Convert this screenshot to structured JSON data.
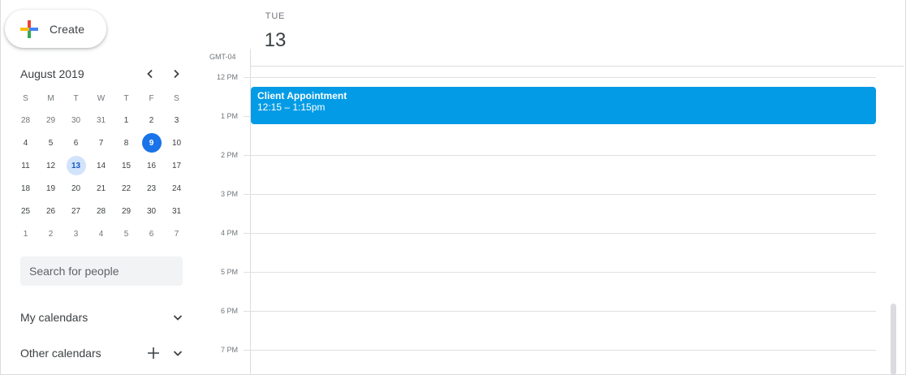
{
  "create": {
    "label": "Create",
    "icon": "google-plus-icon"
  },
  "mini_calendar": {
    "title": "August 2019",
    "prev_icon": "chevron-left-icon",
    "next_icon": "chevron-right-icon",
    "weekdays": [
      "S",
      "M",
      "T",
      "W",
      "T",
      "F",
      "S"
    ],
    "weeks": [
      [
        {
          "d": "28",
          "other": true
        },
        {
          "d": "29",
          "other": true
        },
        {
          "d": "30",
          "other": true
        },
        {
          "d": "31",
          "other": true
        },
        {
          "d": "1"
        },
        {
          "d": "2"
        },
        {
          "d": "3"
        }
      ],
      [
        {
          "d": "4"
        },
        {
          "d": "5"
        },
        {
          "d": "6"
        },
        {
          "d": "7"
        },
        {
          "d": "8"
        },
        {
          "d": "9",
          "today": true
        },
        {
          "d": "10"
        }
      ],
      [
        {
          "d": "11"
        },
        {
          "d": "12"
        },
        {
          "d": "13",
          "selected": true
        },
        {
          "d": "14"
        },
        {
          "d": "15"
        },
        {
          "d": "16"
        },
        {
          "d": "17"
        }
      ],
      [
        {
          "d": "18"
        },
        {
          "d": "19"
        },
        {
          "d": "20"
        },
        {
          "d": "21"
        },
        {
          "d": "22"
        },
        {
          "d": "23"
        },
        {
          "d": "24"
        }
      ],
      [
        {
          "d": "25"
        },
        {
          "d": "26"
        },
        {
          "d": "27"
        },
        {
          "d": "28"
        },
        {
          "d": "29"
        },
        {
          "d": "30"
        },
        {
          "d": "31"
        }
      ],
      [
        {
          "d": "1",
          "other": true
        },
        {
          "d": "2",
          "other": true
        },
        {
          "d": "3",
          "other": true
        },
        {
          "d": "4",
          "other": true
        },
        {
          "d": "5",
          "other": true
        },
        {
          "d": "6",
          "other": true
        },
        {
          "d": "7",
          "other": true
        }
      ]
    ]
  },
  "search": {
    "placeholder": "Search for people"
  },
  "my_calendars": {
    "label": "My calendars"
  },
  "other_calendars": {
    "label": "Other calendars"
  },
  "day_view": {
    "day_of_week": "TUE",
    "date": "13",
    "timezone": "GMT-04",
    "hours": [
      "12 PM",
      "1 PM",
      "2 PM",
      "3 PM",
      "4 PM",
      "5 PM",
      "6 PM",
      "7 PM"
    ]
  },
  "event": {
    "title": "Client Appointment",
    "time": "12:15 – 1:15pm",
    "color": "#039be5"
  },
  "colors": {
    "accent": "#1a73e8",
    "today_text": "#ffffff",
    "selected_bg": "#d2e3fc"
  }
}
